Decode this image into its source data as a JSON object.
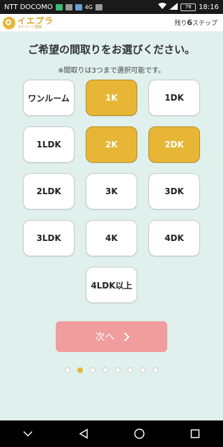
{
  "status_bar": {
    "carrier": "NTT DOCOMO",
    "network": "4G",
    "battery": "78",
    "time": "18:16"
  },
  "header": {
    "logo_title": "イエプラ",
    "logo_sub": "マイページ登録",
    "steps_prefix": "残り",
    "steps_count": "6",
    "steps_suffix": "ステップ"
  },
  "main": {
    "title": "ご希望の間取りをお選びください。",
    "note": "※間取りは3つまで選択可能です。"
  },
  "options": [
    {
      "label": "ワンルーム",
      "selected": false
    },
    {
      "label": "1K",
      "selected": true
    },
    {
      "label": "1DK",
      "selected": false
    },
    {
      "label": "1LDK",
      "selected": false
    },
    {
      "label": "2K",
      "selected": true
    },
    {
      "label": "2DK",
      "selected": true
    },
    {
      "label": "2LDK",
      "selected": false
    },
    {
      "label": "3K",
      "selected": false
    },
    {
      "label": "3DK",
      "selected": false
    },
    {
      "label": "3LDK",
      "selected": false
    },
    {
      "label": "4K",
      "selected": false
    },
    {
      "label": "4DK",
      "selected": false
    },
    {
      "label": "4LDK以上",
      "selected": false
    }
  ],
  "next_button": {
    "label": "次へ"
  },
  "pager": {
    "total": 8,
    "current": 2
  },
  "colors": {
    "selected": "#e8b637",
    "next": "#f19c9d",
    "background": "#dff0ed"
  },
  "nav": {
    "icons": [
      "chevron-down-icon",
      "back-icon",
      "home-icon",
      "recents-icon"
    ]
  }
}
